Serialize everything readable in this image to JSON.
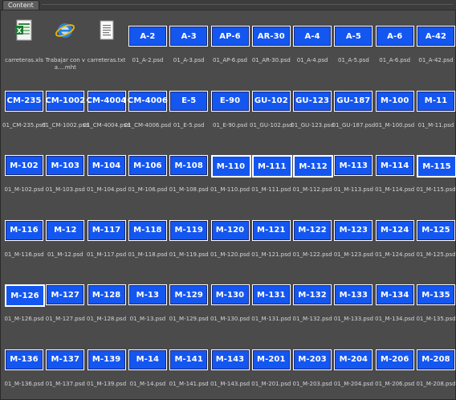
{
  "panel": {
    "tab_label": "Content"
  },
  "items": [
    {
      "kind": "file",
      "icon": "excel-file-icon",
      "caption": "carreteras.xls"
    },
    {
      "kind": "file",
      "icon": "internet-explorer-icon",
      "caption": "Trabajar con va....mht"
    },
    {
      "kind": "file",
      "icon": "text-file-icon",
      "caption": "carreteras.txt"
    },
    {
      "kind": "psd",
      "label": "A-2",
      "caption": "01_A-2.psd"
    },
    {
      "kind": "psd",
      "label": "A-3",
      "caption": "01_A-3.psd"
    },
    {
      "kind": "psd",
      "label": "AP-6",
      "caption": "01_AP-6.psd"
    },
    {
      "kind": "psd",
      "label": "AR-30",
      "caption": "01_AR-30.psd"
    },
    {
      "kind": "psd",
      "label": "A-4",
      "caption": "01_A-4.psd"
    },
    {
      "kind": "psd",
      "label": "A-5",
      "caption": "01_A-5.psd"
    },
    {
      "kind": "psd",
      "label": "A-6",
      "caption": "01_A-6.psd"
    },
    {
      "kind": "psd",
      "label": "A-42",
      "caption": "01_A-42.psd"
    },
    {
      "kind": "psd",
      "label": "CM-235",
      "caption": "01_CM-235.psd"
    },
    {
      "kind": "psd",
      "label": "CM-1002",
      "caption": "01_CM-1002.psd"
    },
    {
      "kind": "psd",
      "label": "CM-4004",
      "caption": "01_CM-4004.psd"
    },
    {
      "kind": "psd",
      "label": "CM-4006",
      "caption": "01_CM-4006.psd"
    },
    {
      "kind": "psd",
      "label": "E-5",
      "caption": "01_E-5.psd"
    },
    {
      "kind": "psd",
      "label": "E-90",
      "caption": "01_E-90.psd"
    },
    {
      "kind": "psd",
      "label": "GU-102",
      "caption": "01_GU-102.psd"
    },
    {
      "kind": "psd",
      "label": "GU-123",
      "caption": "01_GU-123.psd"
    },
    {
      "kind": "psd",
      "label": "GU-187",
      "caption": "01_GU-187.psd"
    },
    {
      "kind": "psd",
      "label": "M-100",
      "caption": "01_M-100.psd"
    },
    {
      "kind": "psd",
      "label": "M-11",
      "caption": "01_M-11.psd"
    },
    {
      "kind": "psd",
      "label": "M-102",
      "caption": "01_M-102.psd"
    },
    {
      "kind": "psd",
      "label": "M-103",
      "caption": "01_M-103.psd"
    },
    {
      "kind": "psd",
      "label": "M-104",
      "caption": "01_M-104.psd"
    },
    {
      "kind": "psd",
      "label": "M-106",
      "caption": "01_M-106.psd"
    },
    {
      "kind": "psd",
      "label": "M-108",
      "caption": "01_M-108.psd"
    },
    {
      "kind": "psd",
      "label": "M-110",
      "caption": "01_M-110.psd"
    },
    {
      "kind": "psd",
      "label": "M-111",
      "caption": "01_M-111.psd"
    },
    {
      "kind": "psd",
      "label": "M-112",
      "caption": "01_M-112.psd"
    },
    {
      "kind": "psd",
      "label": "M-113",
      "caption": "01_M-113.psd"
    },
    {
      "kind": "psd",
      "label": "M-114",
      "caption": "01_M-114.psd"
    },
    {
      "kind": "psd",
      "label": "M-115",
      "caption": "01_M-115.psd"
    },
    {
      "kind": "psd",
      "label": "M-116",
      "caption": "01_M-116.psd"
    },
    {
      "kind": "psd",
      "label": "M-12",
      "caption": "01_M-12.psd"
    },
    {
      "kind": "psd",
      "label": "M-117",
      "caption": "01_M-117.psd"
    },
    {
      "kind": "psd",
      "label": "M-118",
      "caption": "01_M-118.psd"
    },
    {
      "kind": "psd",
      "label": "M-119",
      "caption": "01_M-119.psd"
    },
    {
      "kind": "psd",
      "label": "M-120",
      "caption": "01_M-120.psd"
    },
    {
      "kind": "psd",
      "label": "M-121",
      "caption": "01_M-121.psd"
    },
    {
      "kind": "psd",
      "label": "M-122",
      "caption": "01_M-122.psd"
    },
    {
      "kind": "psd",
      "label": "M-123",
      "caption": "01_M-123.psd"
    },
    {
      "kind": "psd",
      "label": "M-124",
      "caption": "01_M-124.psd"
    },
    {
      "kind": "psd",
      "label": "M-125",
      "caption": "01_M-125.psd"
    },
    {
      "kind": "psd",
      "label": "M-126",
      "caption": "01_M-126.psd"
    },
    {
      "kind": "psd",
      "label": "M-127",
      "caption": "01_M-127.psd"
    },
    {
      "kind": "psd",
      "label": "M-128",
      "caption": "01_M-128.psd"
    },
    {
      "kind": "psd",
      "label": "M-13",
      "caption": "01_M-13.psd"
    },
    {
      "kind": "psd",
      "label": "M-129",
      "caption": "01_M-129.psd"
    },
    {
      "kind": "psd",
      "label": "M-130",
      "caption": "01_M-130.psd"
    },
    {
      "kind": "psd",
      "label": "M-131",
      "caption": "01_M-131.psd"
    },
    {
      "kind": "psd",
      "label": "M-132",
      "caption": "01_M-132.psd"
    },
    {
      "kind": "psd",
      "label": "M-133",
      "caption": "01_M-133.psd"
    },
    {
      "kind": "psd",
      "label": "M-134",
      "caption": "01_M-134.psd"
    },
    {
      "kind": "psd",
      "label": "M-135",
      "caption": "01_M-135.psd"
    },
    {
      "kind": "psd",
      "label": "M-136",
      "caption": "01_M-136.psd"
    },
    {
      "kind": "psd",
      "label": "M-137",
      "caption": "01_M-137.psd"
    },
    {
      "kind": "psd",
      "label": "M-139",
      "caption": "01_M-139.psd"
    },
    {
      "kind": "psd",
      "label": "M-14",
      "caption": "01_M-14.psd"
    },
    {
      "kind": "psd",
      "label": "M-141",
      "caption": "01_M-141.psd"
    },
    {
      "kind": "psd",
      "label": "M-143",
      "caption": "01_M-143.psd"
    },
    {
      "kind": "psd",
      "label": "M-201",
      "caption": "01_M-201.psd"
    },
    {
      "kind": "psd",
      "label": "M-203",
      "caption": "01_M-203.psd"
    },
    {
      "kind": "psd",
      "label": "M-204",
      "caption": "01_M-204.psd"
    },
    {
      "kind": "psd",
      "label": "M-206",
      "caption": "01_M-206.psd"
    },
    {
      "kind": "psd",
      "label": "M-208",
      "caption": "01_M-208.psd"
    }
  ],
  "colors": {
    "thumb_blue": "#1456f0",
    "panel_bg": "#4b4b4b",
    "caption": "#d6d6d6"
  }
}
